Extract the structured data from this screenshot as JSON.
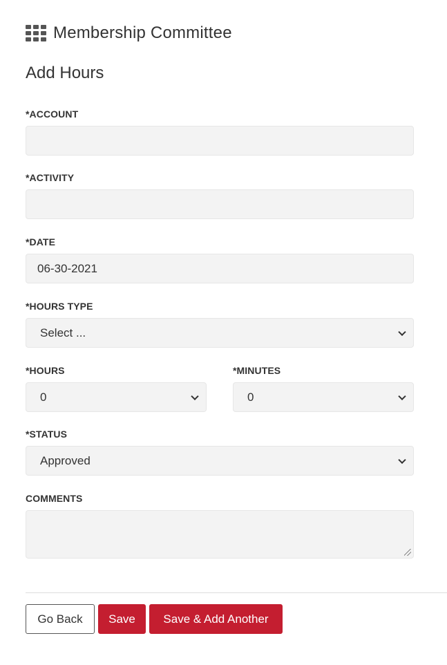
{
  "header": {
    "title": "Membership Committee",
    "icon": "apps-grid-icon"
  },
  "page_title": "Add Hours",
  "form": {
    "account": {
      "label": "*ACCOUNT",
      "value": ""
    },
    "activity": {
      "label": "*ACTIVITY",
      "value": ""
    },
    "date": {
      "label": "*DATE",
      "value": "06-30-2021"
    },
    "hours_type": {
      "label": "*HOURS TYPE",
      "value": "Select ..."
    },
    "hours": {
      "label": "*HOURS",
      "value": "0"
    },
    "minutes": {
      "label": "*MINUTES",
      "value": "0"
    },
    "status": {
      "label": "*STATUS",
      "value": "Approved"
    },
    "comments": {
      "label": "COMMENTS",
      "value": ""
    }
  },
  "buttons": {
    "go_back": "Go Back",
    "save": "Save",
    "save_add_another": "Save & Add Another"
  },
  "colors": {
    "primary": "#c41e30",
    "field_bg": "#f3f3f3",
    "text": "#333333"
  }
}
